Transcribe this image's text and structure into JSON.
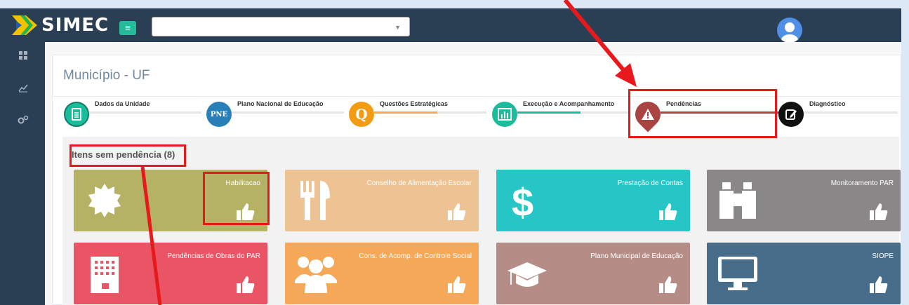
{
  "app": {
    "name": "SIMEC"
  },
  "header": {
    "select_value": ""
  },
  "page": {
    "title": "Município - UF"
  },
  "steps": [
    {
      "label": "Dados da Unidade",
      "color": "#1abc9c",
      "icon": "document-icon"
    },
    {
      "label": "Plano Nacional de Educação",
      "color": "#2980b9",
      "icon_text": "PNE"
    },
    {
      "label": "Questões Estratégicas",
      "color": "#f39c12",
      "icon_text": "Q"
    },
    {
      "label": "Execução e Acompanhamento",
      "color": "#1abc9c",
      "icon": "chart-icon"
    },
    {
      "label": "Pendências",
      "color": "#a94442",
      "icon": "warning-icon"
    },
    {
      "label": "Diagnóstico",
      "color": "#111111",
      "icon": "edit-icon"
    }
  ],
  "section": {
    "title": "Itens sem pendência (8)"
  },
  "tiles": [
    {
      "label": "Habilitacao",
      "color": "#b5b265",
      "icon": "seal-icon"
    },
    {
      "label": "Conselho de Alimentação Escolar",
      "color": "#edc393",
      "icon": "fork-knife-icon"
    },
    {
      "label": "Prestação de Contas",
      "color": "#26c6c6",
      "icon": "dollar-icon"
    },
    {
      "label": "Monitoramento PAR",
      "color": "#8a8788",
      "icon": "binoculars-icon"
    },
    {
      "label": "Pendências de Obras do PAR",
      "color": "#ea5566",
      "icon": "building-icon"
    },
    {
      "label": "Cons. de Acomp. de Controle Social",
      "color": "#f5a857",
      "icon": "users-icon"
    },
    {
      "label": "Plano Municipal de Educação",
      "color": "#b68c86",
      "icon": "graduation-cap-icon"
    },
    {
      "label": "SIOPE",
      "color": "#476d8b",
      "icon": "monitor-icon"
    }
  ]
}
